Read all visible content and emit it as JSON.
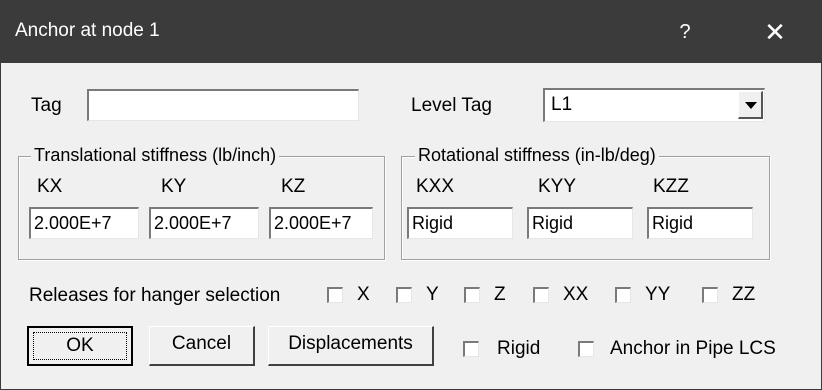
{
  "window": {
    "title": "Anchor at node 1",
    "help": "?",
    "close": "✕"
  },
  "tag": {
    "label": "Tag",
    "value": ""
  },
  "level_tag": {
    "label": "Level Tag",
    "value": "L1"
  },
  "translational": {
    "title": "Translational stiffness (lb/inch)",
    "kx": {
      "label": "KX",
      "value": "2.000E+7"
    },
    "ky": {
      "label": "KY",
      "value": "2.000E+7"
    },
    "kz": {
      "label": "KZ",
      "value": "2.000E+7"
    }
  },
  "rotational": {
    "title": "Rotational stiffness (in-lb/deg)",
    "kxx": {
      "label": "KXX",
      "value": "Rigid"
    },
    "kyy": {
      "label": "KYY",
      "value": "Rigid"
    },
    "kzz": {
      "label": "KZZ",
      "value": "Rigid"
    }
  },
  "releases": {
    "label": "Releases for hanger selection",
    "x": "X",
    "y": "Y",
    "z": "Z",
    "xx": "XX",
    "yy": "YY",
    "zz": "ZZ"
  },
  "buttons": {
    "ok": "OK",
    "cancel": "Cancel",
    "displacements": "Displacements"
  },
  "options": {
    "rigid": "Rigid",
    "anchor_pipe_lcs": "Anchor in Pipe LCS"
  }
}
